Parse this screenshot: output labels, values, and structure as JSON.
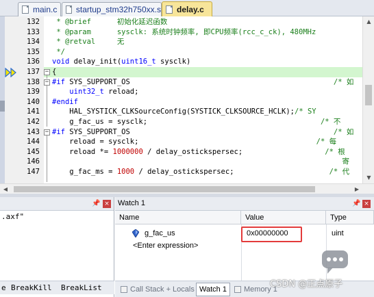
{
  "tabs": [
    {
      "label": "main.c",
      "active": false
    },
    {
      "label": "startup_stm32h750xx.s",
      "active": false
    },
    {
      "label": "delay.c",
      "active": true
    }
  ],
  "editor": {
    "current_line": 137,
    "lines": [
      {
        "n": "132",
        "html": "<span class=\"cm\">&nbsp;*&nbsp;@brief&nbsp;&nbsp;&nbsp;&nbsp;&nbsp;&nbsp;初始化延迟函数</span>"
      },
      {
        "n": "133",
        "html": "<span class=\"cm\">&nbsp;*&nbsp;@param&nbsp;&nbsp;&nbsp;&nbsp;&nbsp;&nbsp;sysclk:&nbsp;系统时钟频率,&nbsp;即CPU频率(rcc_c_ck),&nbsp;480MHz</span>"
      },
      {
        "n": "134",
        "html": "<span class=\"cm\">&nbsp;*&nbsp;@retval&nbsp;&nbsp;&nbsp;&nbsp;&nbsp;无</span>"
      },
      {
        "n": "135",
        "html": "<span class=\"cm\">&nbsp;*/</span>"
      },
      {
        "n": "136",
        "html": "<span class=\"kw\">void</span>&nbsp;delay_init(<span class=\"kw\">uint16_t</span>&nbsp;sysclk)"
      },
      {
        "n": "137",
        "html": "{"
      },
      {
        "n": "138",
        "html": "<span class=\"pp\">#if</span>&nbsp;SYS_SUPPORT_OS<span class=\"dot\">&nbsp;&nbsp;&nbsp;&nbsp;&nbsp;&nbsp;&nbsp;&nbsp;&nbsp;&nbsp;&nbsp;&nbsp;&nbsp;&nbsp;&nbsp;&nbsp;&nbsp;&nbsp;&nbsp;&nbsp;&nbsp;&nbsp;&nbsp;&nbsp;&nbsp;&nbsp;&nbsp;&nbsp;&nbsp;&nbsp;&nbsp;&nbsp;&nbsp;&nbsp;&nbsp;&nbsp;&nbsp;&nbsp;&nbsp;&nbsp;&nbsp;&nbsp;&nbsp;&nbsp;&nbsp;&nbsp;&nbsp;</span><span class=\"cm\">/*&nbsp;如</span>"
      },
      {
        "n": "139",
        "html": "&nbsp;&nbsp;&nbsp;&nbsp;<span class=\"kw\">uint32_t</span>&nbsp;reload;"
      },
      {
        "n": "140",
        "html": "<span class=\"pp\">#endif</span>"
      },
      {
        "n": "141",
        "html": "&nbsp;&nbsp;&nbsp;&nbsp;HAL_SYSTICK_CLKSourceConfig(SYSTICK_CLKSOURCE_HCLK);<span class=\"cm\">/*&nbsp;SY</span>"
      },
      {
        "n": "142",
        "html": "&nbsp;&nbsp;&nbsp;&nbsp;g_fac_us&nbsp;=&nbsp;sysclk;<span class=\"dot\">&nbsp;&nbsp;&nbsp;&nbsp;&nbsp;&nbsp;&nbsp;&nbsp;&nbsp;&nbsp;&nbsp;&nbsp;&nbsp;&nbsp;&nbsp;&nbsp;&nbsp;&nbsp;&nbsp;&nbsp;&nbsp;&nbsp;&nbsp;&nbsp;&nbsp;&nbsp;&nbsp;&nbsp;&nbsp;&nbsp;&nbsp;&nbsp;&nbsp;&nbsp;&nbsp;&nbsp;&nbsp;&nbsp;&nbsp;&nbsp;</span><span class=\"cm\">/*&nbsp;不</span>"
      },
      {
        "n": "143",
        "html": "<span class=\"pp\">#if</span>&nbsp;SYS_SUPPORT_OS<span class=\"dot\">&nbsp;&nbsp;&nbsp;&nbsp;&nbsp;&nbsp;&nbsp;&nbsp;&nbsp;&nbsp;&nbsp;&nbsp;&nbsp;&nbsp;&nbsp;&nbsp;&nbsp;&nbsp;&nbsp;&nbsp;&nbsp;&nbsp;&nbsp;&nbsp;&nbsp;&nbsp;&nbsp;&nbsp;&nbsp;&nbsp;&nbsp;&nbsp;&nbsp;&nbsp;&nbsp;&nbsp;&nbsp;&nbsp;&nbsp;&nbsp;&nbsp;&nbsp;&nbsp;&nbsp;&nbsp;&nbsp;&nbsp;</span><span class=\"cm\">/*&nbsp;如</span>"
      },
      {
        "n": "144",
        "html": "&nbsp;&nbsp;&nbsp;&nbsp;reload&nbsp;=&nbsp;sysclk;<span class=\"dot\">&nbsp;&nbsp;&nbsp;&nbsp;&nbsp;&nbsp;&nbsp;&nbsp;&nbsp;&nbsp;&nbsp;&nbsp;&nbsp;&nbsp;&nbsp;&nbsp;&nbsp;&nbsp;&nbsp;&nbsp;&nbsp;&nbsp;&nbsp;&nbsp;&nbsp;&nbsp;&nbsp;&nbsp;&nbsp;&nbsp;&nbsp;&nbsp;&nbsp;&nbsp;&nbsp;&nbsp;&nbsp;&nbsp;&nbsp;&nbsp;&nbsp;</span><span class=\"cm\">/*&nbsp;每</span>"
      },
      {
        "n": "145",
        "html": "&nbsp;&nbsp;&nbsp;&nbsp;reload&nbsp;*=&nbsp;<span class=\"num\">1000000</span>&nbsp;/&nbsp;delay_ostickspersec;<span class=\"dot\">&nbsp;&nbsp;&nbsp;&nbsp;&nbsp;&nbsp;&nbsp;&nbsp;&nbsp;&nbsp;&nbsp;&nbsp;&nbsp;&nbsp;&nbsp;&nbsp;&nbsp;&nbsp;&nbsp;</span><span class=\"cm\">/*&nbsp;根</span>"
      },
      {
        "n": "146",
        "html": "<span class=\"dot\">&nbsp;&nbsp;&nbsp;&nbsp;&nbsp;&nbsp;&nbsp;&nbsp;&nbsp;&nbsp;&nbsp;&nbsp;&nbsp;&nbsp;&nbsp;&nbsp;&nbsp;&nbsp;&nbsp;&nbsp;&nbsp;&nbsp;&nbsp;&nbsp;&nbsp;&nbsp;&nbsp;&nbsp;&nbsp;&nbsp;&nbsp;&nbsp;&nbsp;&nbsp;&nbsp;&nbsp;&nbsp;&nbsp;&nbsp;&nbsp;&nbsp;&nbsp;&nbsp;&nbsp;&nbsp;&nbsp;&nbsp;&nbsp;&nbsp;&nbsp;&nbsp;&nbsp;&nbsp;&nbsp;&nbsp;&nbsp;&nbsp;&nbsp;&nbsp;&nbsp;&nbsp;&nbsp;&nbsp;&nbsp;</span><span class=\"cm\">&nbsp;&nbsp;&nbsp;寄</span>"
      },
      {
        "n": "147",
        "html": "&nbsp;&nbsp;&nbsp;&nbsp;g_fac_ms&nbsp;=&nbsp;<span class=\"num\">1000</span>&nbsp;/&nbsp;delay_ostickspersec;<span class=\"dot\">&nbsp;&nbsp;&nbsp;&nbsp;&nbsp;&nbsp;&nbsp;&nbsp;&nbsp;&nbsp;&nbsp;&nbsp;&nbsp;&nbsp;&nbsp;&nbsp;&nbsp;&nbsp;&nbsp;&nbsp;&nbsp;&nbsp;</span><span class=\"cm\">/*&nbsp;代</span>"
      }
    ]
  },
  "left_pane": {
    "text": ".axf\"",
    "buttons": [
      "e",
      "BreakKill",
      "BreakList"
    ]
  },
  "watch": {
    "title": "Watch 1",
    "columns": [
      "Name",
      "Value",
      "Type"
    ],
    "rows": [
      {
        "name": "g_fac_us",
        "value": "0x00000000",
        "type": "uint"
      },
      {
        "name": "<Enter expression>",
        "value": "",
        "type": ""
      }
    ]
  },
  "bottom_tabs": [
    {
      "label": "Call Stack + Locals",
      "active": false
    },
    {
      "label": "Watch 1",
      "active": true
    },
    {
      "label": "Memory 1",
      "active": false
    }
  ],
  "watermark": "CSDN @正点原子",
  "colors": {
    "comment": "#1b7f1b",
    "keyword": "#0000ff",
    "number": "#c00000",
    "current_line_bg": "#d3f6cf",
    "active_tab": "#f7e59a",
    "highlight_box": "#e33a3a"
  }
}
